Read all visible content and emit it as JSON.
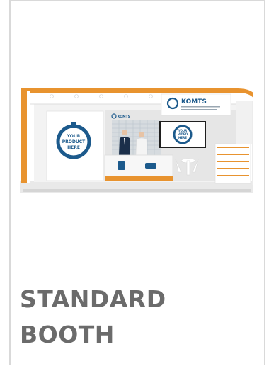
{
  "booth_image": {
    "product_placeholder": [
      "YOUR",
      "PRODUCT",
      "HERE"
    ],
    "video_placeholder": [
      "YOUR",
      "VIDEO",
      "HERE"
    ],
    "brand_name": "KOMTS",
    "accent_color": "#e8932f",
    "logo_color": "#1c5a8c"
  },
  "card": {
    "title_line1": "STANDARD",
    "title_line2": "BOOTH"
  }
}
